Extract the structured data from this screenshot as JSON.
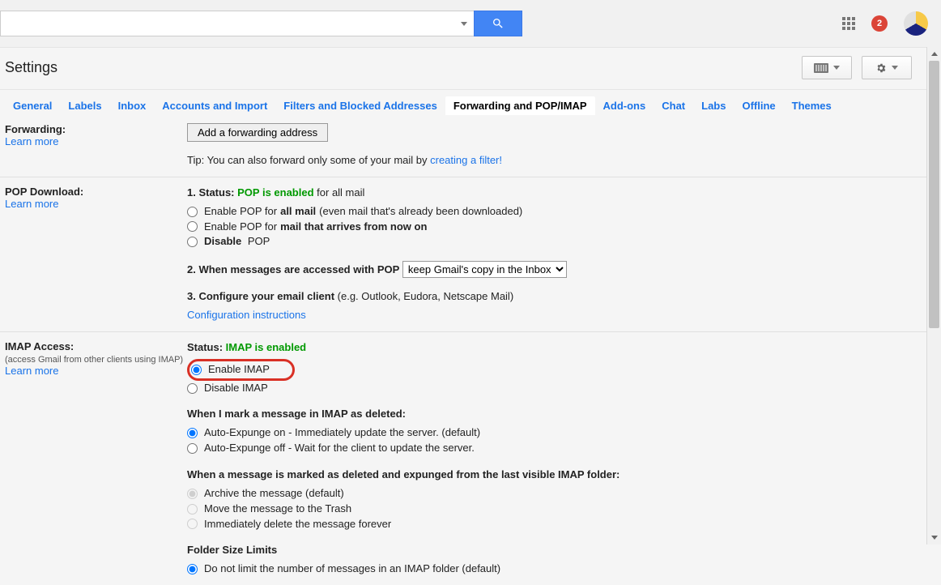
{
  "header": {
    "search_placeholder": "",
    "notifications_count": "2"
  },
  "page_title": "Settings",
  "tabs": [
    {
      "label": "General"
    },
    {
      "label": "Labels"
    },
    {
      "label": "Inbox"
    },
    {
      "label": "Accounts and Import"
    },
    {
      "label": "Filters and Blocked Addresses"
    },
    {
      "label": "Forwarding and POP/IMAP",
      "active": true
    },
    {
      "label": "Add-ons"
    },
    {
      "label": "Chat"
    },
    {
      "label": "Labs"
    },
    {
      "label": "Offline"
    },
    {
      "label": "Themes"
    }
  ],
  "forwarding": {
    "heading": "Forwarding:",
    "learn_more": "Learn more",
    "add_button": "Add a forwarding address",
    "tip_prefix": "Tip: You can also forward only some of your mail by ",
    "tip_link": "creating a filter!"
  },
  "pop": {
    "heading": "POP Download:",
    "learn_more": "Learn more",
    "status_label": "1. Status: ",
    "status_value": "POP is enabled",
    "status_suffix": " for all mail",
    "opt1_prefix": "Enable POP for ",
    "opt1_bold": "all mail",
    "opt1_suffix": " (even mail that's already been downloaded)",
    "opt2_prefix": "Enable POP for ",
    "opt2_bold": "mail that arrives from now on",
    "opt3": "Disable POP",
    "access_label": "2. When messages are accessed with POP",
    "access_select": "keep Gmail's copy in the Inbox",
    "configure_label": "3. Configure your email client",
    "configure_suffix": " (e.g. Outlook, Eudora, Netscape Mail)",
    "configure_link": "Configuration instructions"
  },
  "imap": {
    "heading": "IMAP Access:",
    "subheading": "(access Gmail from other clients using IMAP)",
    "learn_more": "Learn more",
    "status_label": "Status: ",
    "status_value": "IMAP is enabled",
    "opt_enable": "Enable IMAP",
    "opt_disable": "Disable IMAP",
    "deleted_heading": "When I mark a message in IMAP as deleted:",
    "deleted_opt1": "Auto-Expunge on - Immediately update the server. (default)",
    "deleted_opt2": "Auto-Expunge off - Wait for the client to update the server.",
    "expunged_heading": "When a message is marked as deleted and expunged from the last visible IMAP folder:",
    "expunged_opt1": "Archive the message (default)",
    "expunged_opt2": "Move the message to the Trash",
    "expunged_opt3": "Immediately delete the message forever",
    "folder_heading": "Folder Size Limits",
    "folder_opt1": "Do not limit the number of messages in an IMAP folder (default)"
  }
}
